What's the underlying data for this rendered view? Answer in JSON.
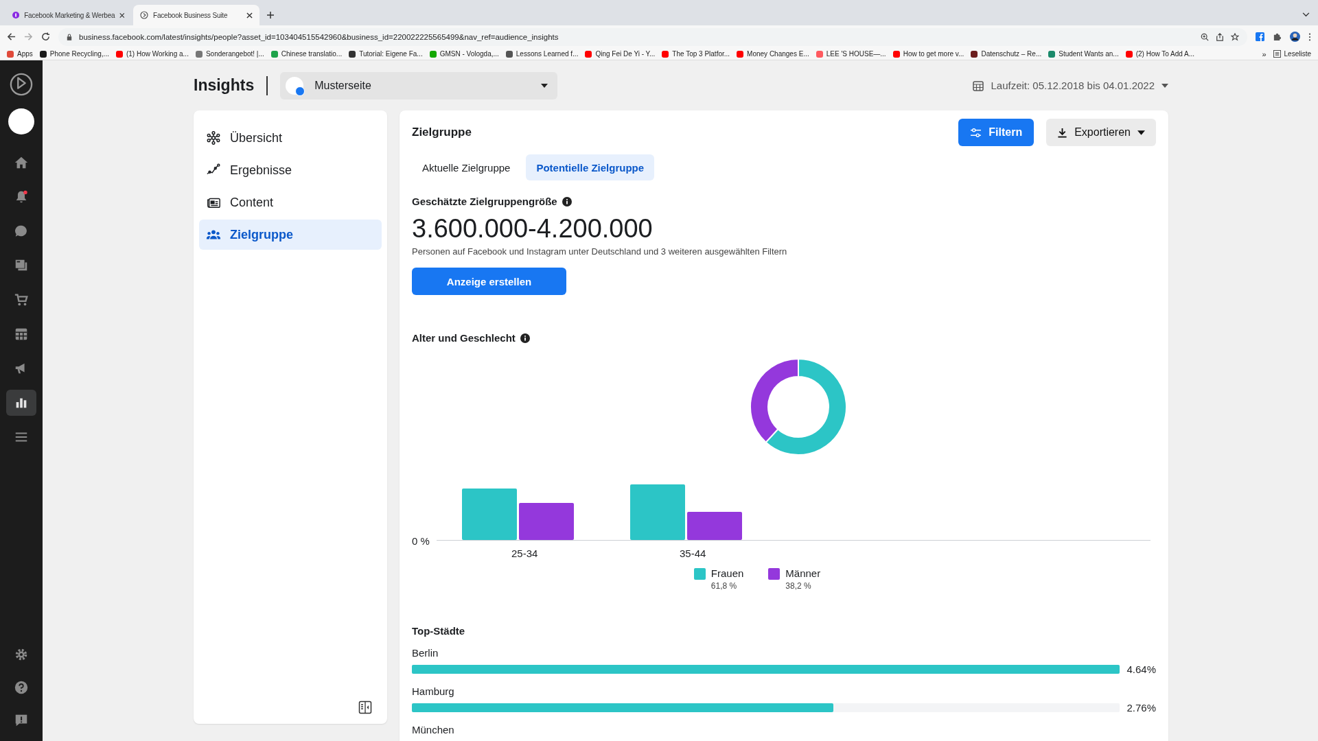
{
  "browser": {
    "tabs": [
      {
        "title": "Facebook Marketing & Werbea",
        "selected": false
      },
      {
        "title": "Facebook Business Suite",
        "selected": true
      }
    ],
    "url": "business.facebook.com/latest/insights/people?asset_id=103404515542960&business_id=220022225565499&nav_ref=audience_insights",
    "bookmarks": [
      {
        "label": "Apps",
        "color": "#e04a3a"
      },
      {
        "label": "Phone Recycling,...",
        "color": "#1a1a1a"
      },
      {
        "label": "(1) How Working a...",
        "color": "#ff0000"
      },
      {
        "label": "Sonderangebot! |...",
        "color": "#777777"
      },
      {
        "label": "Chinese translatio...",
        "color": "#1ea34a"
      },
      {
        "label": "Tutorial: Eigene Fa...",
        "color": "#333333"
      },
      {
        "label": "GMSN - Vologda,...",
        "color": "#14a800"
      },
      {
        "label": "Lessons Learned f...",
        "color": "#555555"
      },
      {
        "label": "Qing Fei De Yi - Y...",
        "color": "#ff0000"
      },
      {
        "label": "The Top 3 Platfor...",
        "color": "#ff0000"
      },
      {
        "label": "Money Changes E...",
        "color": "#ff0000"
      },
      {
        "label": "LEE 'S HOUSE—...",
        "color": "#ff5a5f"
      },
      {
        "label": "How to get more v...",
        "color": "#ff0000"
      },
      {
        "label": "Datenschutz – Re...",
        "color": "#6b1d1d"
      },
      {
        "label": "Student Wants an...",
        "color": "#1b8a6b"
      },
      {
        "label": "(2) How To Add A...",
        "color": "#ff0000"
      }
    ],
    "more": "»",
    "reading_list": "Leseliste"
  },
  "rail": {
    "items": [
      {
        "selected": false
      },
      {
        "selected": false
      },
      {
        "selected": false
      },
      {
        "selected": false
      },
      {
        "selected": false
      },
      {
        "selected": false
      },
      {
        "selected": false
      },
      {
        "selected": true
      },
      {
        "selected": false
      }
    ],
    "notification_badge": true
  },
  "header": {
    "title": "Insights",
    "page": "Musterseite",
    "date_range": "Laufzeit: 05.12.2018 bis 04.01.2022"
  },
  "nav": [
    {
      "label": "Übersicht",
      "selected": false
    },
    {
      "label": "Ergebnisse",
      "selected": false
    },
    {
      "label": "Content",
      "selected": false
    },
    {
      "label": "Zielgruppe",
      "selected": true
    }
  ],
  "main": {
    "title": "Zielgruppe",
    "filter_button": "Filtern",
    "export_button": "Exportieren",
    "tabs": [
      {
        "label": "Aktuelle Zielgruppe",
        "selected": false
      },
      {
        "label": "Potentielle Zielgruppe",
        "selected": true
      }
    ],
    "size_label": "Geschätzte Zielgruppengröße",
    "size_value": "3.600.000-4.200.000",
    "size_note": "Personen auf Facebook und Instagram unter Deutschland und 3 weiteren ausgewählten Filtern",
    "create_ad_button": "Anzeige erstellen",
    "age_gender": {
      "title": "Alter und Geschlecht",
      "chart_data": {
        "type": "donut",
        "categories": [
          "Frauen",
          "Männer"
        ],
        "values": [
          61.8,
          38.2
        ]
      },
      "bar_axis_label": "0 %",
      "bar_categories": [
        "25-34",
        "35-44"
      ],
      "legend": [
        {
          "value": "61,8 %",
          "color": "#2cc5c6"
        },
        {
          "value": "38,2 %",
          "color": "#9438dc"
        }
      ]
    },
    "top_cities": {
      "title": "Top-Städte",
      "rows": [
        {
          "name": "Berlin",
          "level": 1,
          "reading": "4.64%"
        },
        {
          "name": "Hamburg",
          "level": 0.595,
          "reading": "2.76%"
        },
        {
          "name": "München"
        }
      ]
    }
  }
}
